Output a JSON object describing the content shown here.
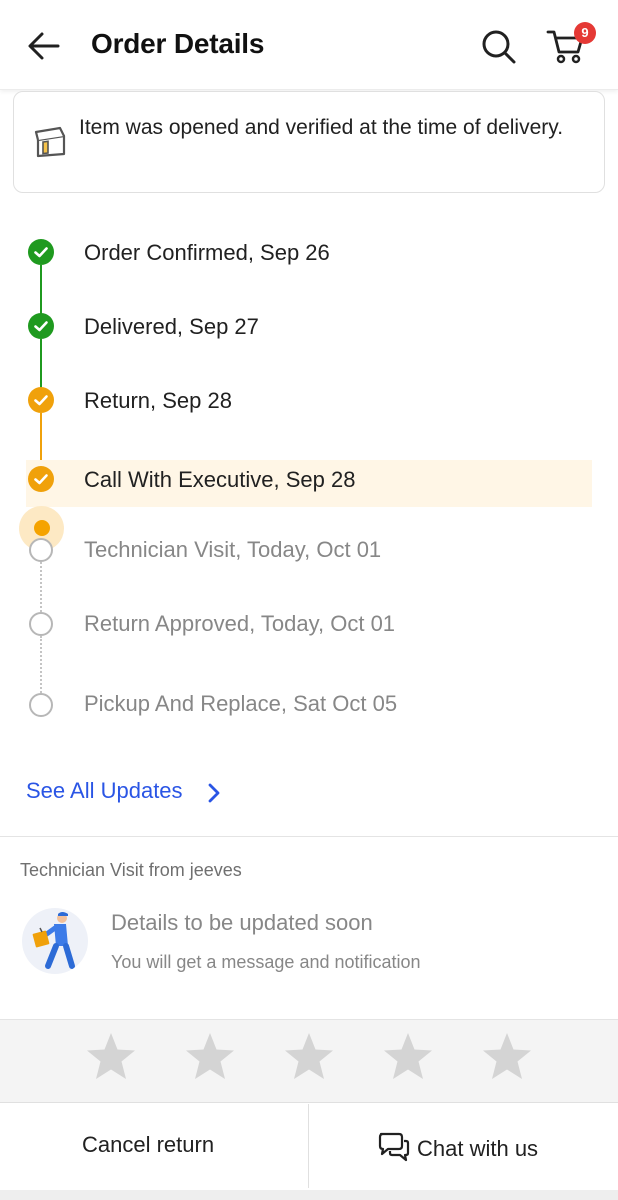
{
  "header": {
    "title": "Order Details",
    "cart_count": "9",
    "back_icon": "arrow-left-icon",
    "search_icon": "search-icon",
    "cart_icon": "cart-icon"
  },
  "info_card": {
    "icon": "open-box-icon",
    "text": "Item was opened and verified at the time of delivery."
  },
  "timeline": {
    "steps": [
      {
        "label": "Order Confirmed, Sep 26",
        "status": "done"
      },
      {
        "label": "Delivered, Sep 27",
        "status": "done"
      },
      {
        "label": "Return, Sep 28",
        "status": "done"
      },
      {
        "label": "Call With Executive, Sep 28",
        "status": "done"
      },
      {
        "label": "Technician Visit, Today, Oct 01",
        "status": "pending"
      },
      {
        "label": "Return Approved, Today, Oct 01",
        "status": "pending"
      },
      {
        "label": "Pickup And Replace, Sat Oct 05",
        "status": "pending"
      }
    ]
  },
  "see_all": {
    "label": "See All Updates"
  },
  "technician": {
    "heading": "Technician Visit from jeeves",
    "title": "Details to be updated soon",
    "subtitle": "You will get a message and notification"
  },
  "rating": {
    "stars_total": 5,
    "stars_selected": 0
  },
  "footer": {
    "cancel_label": "Cancel return",
    "chat_label": "Chat with us"
  },
  "colors": {
    "green": "#1f9a1f",
    "orange": "#f0a10b",
    "link_blue": "#2a55e5",
    "badge_red": "#e53935",
    "highlight": "#fff6e6"
  }
}
